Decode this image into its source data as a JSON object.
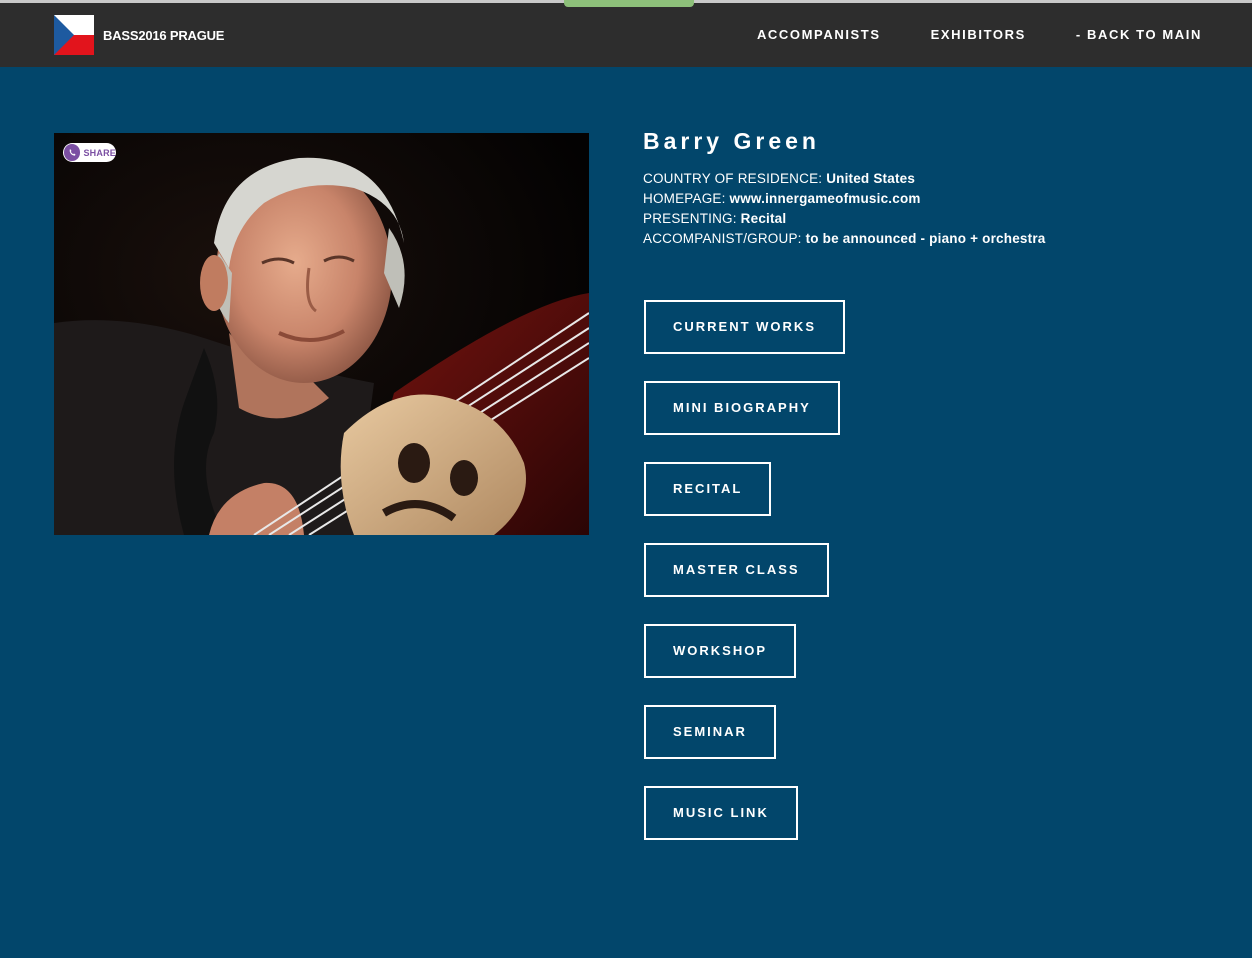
{
  "header": {
    "brand": "BASS2016 PRAGUE",
    "nav": [
      {
        "label": "ACCOMPANISTS"
      },
      {
        "label": "EXHIBITORS"
      },
      {
        "label": "- BACK TO MAIN"
      }
    ]
  },
  "photo": {
    "share_label": "SHARE"
  },
  "profile": {
    "name": "Barry Green",
    "fields": [
      {
        "label": "COUNTRY OF RESIDENCE: ",
        "value": "United States"
      },
      {
        "label": "HOMEPAGE: ",
        "value": "www.innergameofmusic.com"
      },
      {
        "label": "PRESENTING: ",
        "value": "Recital"
      },
      {
        "label": "ACCOMPANIST/GROUP: ",
        "value": "to be announced - piano + orchestra"
      }
    ]
  },
  "buttons": [
    {
      "label": "CURRENT WORKS"
    },
    {
      "label": "MINI BIOGRAPHY"
    },
    {
      "label": "RECITAL"
    },
    {
      "label": "MASTER CLASS"
    },
    {
      "label": "WORKSHOP"
    },
    {
      "label": "SEMINAR"
    },
    {
      "label": "MUSIC LINK"
    }
  ],
  "colors": {
    "background": "#02466b",
    "header": "#2d2d2d",
    "accent_tab": "#8dc07a",
    "viber_purple": "#7b4fa3"
  }
}
